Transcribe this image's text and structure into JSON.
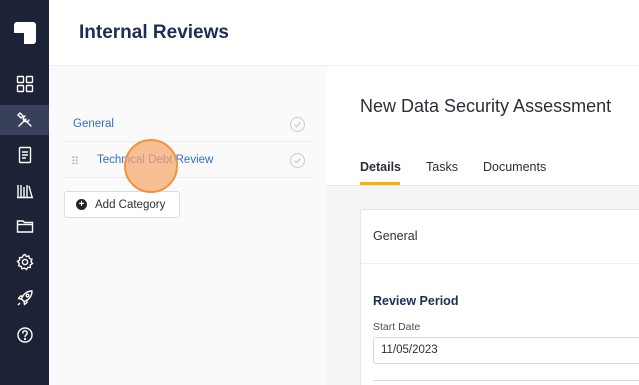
{
  "app": {
    "logo_icon": "app-logo-icon"
  },
  "sidebar": {
    "items": [
      {
        "name": "dashboard",
        "icon": "grid-icon",
        "active": false
      },
      {
        "name": "tools",
        "icon": "tools-icon",
        "active": true
      },
      {
        "name": "documents",
        "icon": "document-icon",
        "active": false
      },
      {
        "name": "library",
        "icon": "library-icon",
        "active": false
      },
      {
        "name": "folders",
        "icon": "folder-icon",
        "active": false
      },
      {
        "name": "settings",
        "icon": "gear-icon",
        "active": false
      },
      {
        "name": "launch",
        "icon": "rocket-icon",
        "active": false
      },
      {
        "name": "help",
        "icon": "help-icon",
        "active": false
      }
    ]
  },
  "header": {
    "title": "Internal Reviews"
  },
  "categories": {
    "items": [
      {
        "label": "General",
        "completed": true
      },
      {
        "label": "Technical Debt Review",
        "completed": true
      }
    ],
    "add_label": "Add Category"
  },
  "main": {
    "title": "New Data Security Assessment",
    "tabs": [
      {
        "label": "Details",
        "active": true
      },
      {
        "label": "Tasks",
        "active": false
      },
      {
        "label": "Documents",
        "active": false
      }
    ],
    "card": {
      "section_label": "General",
      "review_period_heading": "Review Period",
      "start_date_label": "Start Date",
      "start_date_value": "11/05/2023"
    }
  },
  "colors": {
    "sidebar_bg": "#1d2336",
    "accent_link": "#2f6fc6",
    "tab_indicator": "#f4b400",
    "title_navy": "#1f2d55",
    "cursor_highlight": "#f0933f"
  }
}
